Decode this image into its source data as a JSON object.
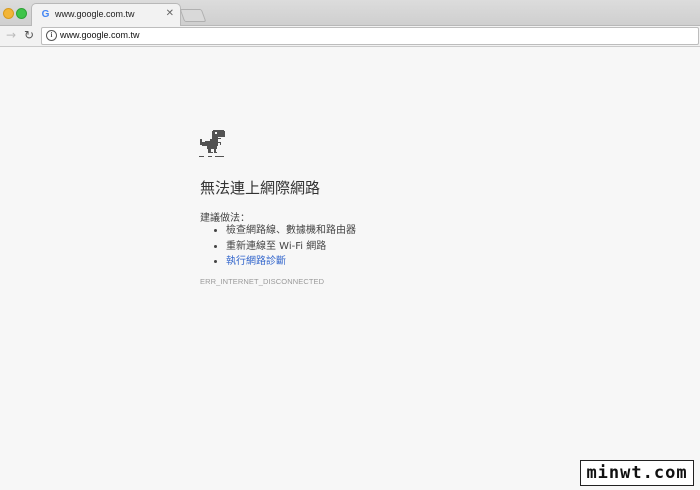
{
  "tab": {
    "favicon": "google-g-icon",
    "title": "www.google.com.tw",
    "close": "✕"
  },
  "toolbar": {
    "forward_glyph": "→",
    "reload_glyph": "↻",
    "url": "www.google.com.tw"
  },
  "page": {
    "title": "無法連上網際網路",
    "suggest_label": "建議做法：",
    "suggestions": [
      "檢查網路線、數據機和路由器",
      "重新連線至 Wi-Fi 網路"
    ],
    "diagnostics_link": "執行網路診斷",
    "error_code": "ERR_INTERNET_DISCONNECTED"
  },
  "watermark": "minwt.com",
  "colors": {
    "link": "#3366cc",
    "page_bg": "#f7f7f7",
    "dino": "#535353"
  }
}
